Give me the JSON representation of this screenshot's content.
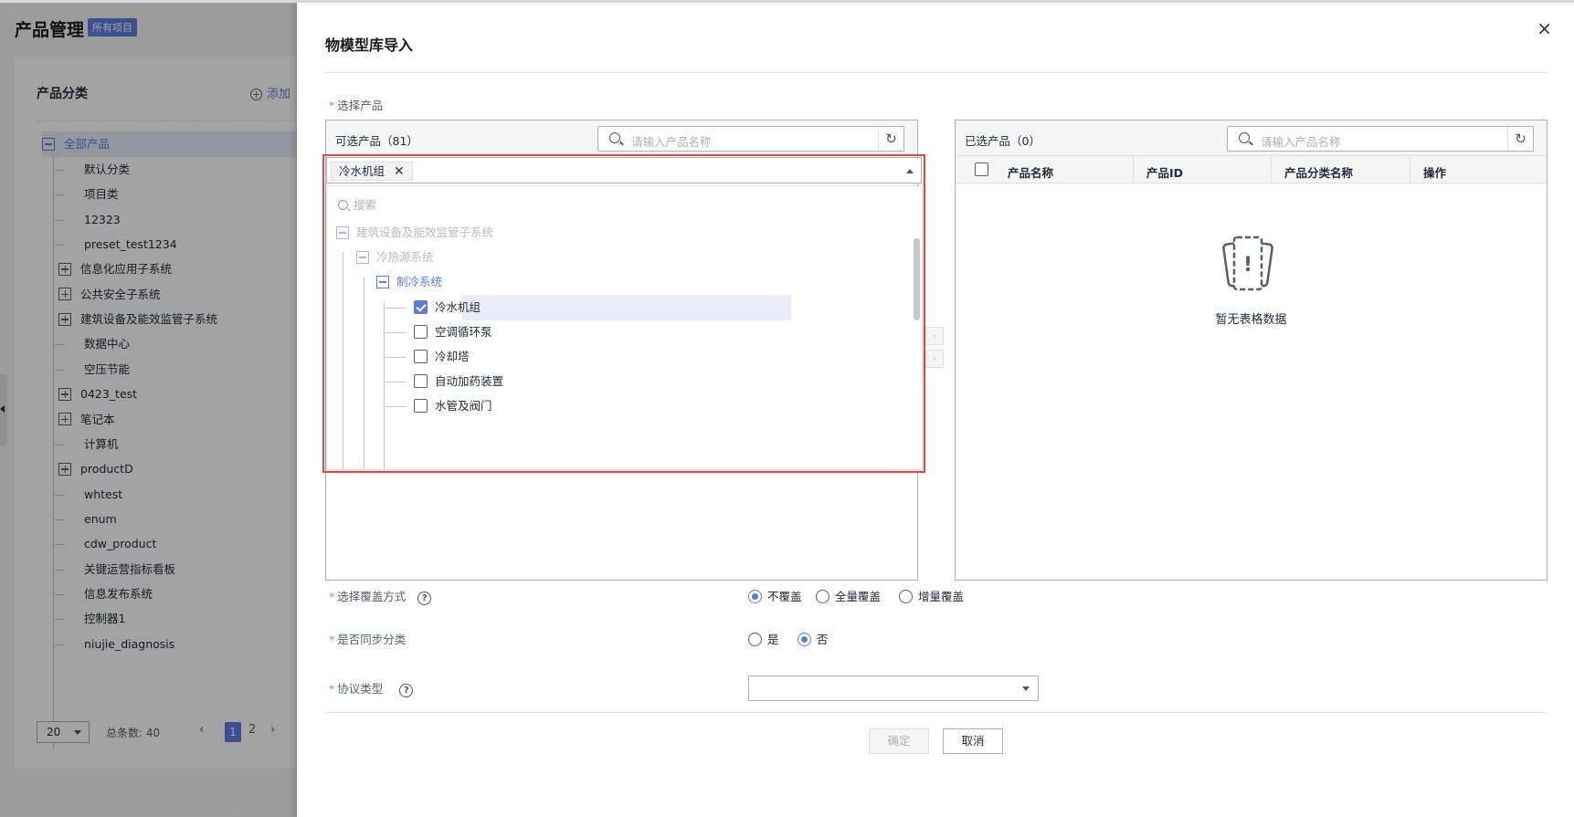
{
  "background": {
    "title": "产品管理",
    "badge": "所有项目",
    "category_title": "产品分类",
    "add_label": "添加",
    "root": "全部产品",
    "items": [
      {
        "label": "默认分类",
        "expandable": false
      },
      {
        "label": "项目类",
        "expandable": false
      },
      {
        "label": "12323",
        "expandable": false
      },
      {
        "label": "preset_test1234",
        "expandable": false
      },
      {
        "label": "信息化应用子系统",
        "expandable": true
      },
      {
        "label": "公共安全子系统",
        "expandable": true
      },
      {
        "label": "建筑设备及能效监管子系统",
        "expandable": true
      },
      {
        "label": "数据中心",
        "expandable": false
      },
      {
        "label": "空压节能",
        "expandable": false
      },
      {
        "label": "0423_test",
        "expandable": true
      },
      {
        "label": "笔记本",
        "expandable": true
      },
      {
        "label": "计算机",
        "expandable": false
      },
      {
        "label": "productD",
        "expandable": true
      },
      {
        "label": "whtest",
        "expandable": false
      },
      {
        "label": "enum",
        "expandable": false
      },
      {
        "label": "cdw_product",
        "expandable": false
      },
      {
        "label": "关键运营指标看板",
        "expandable": false
      },
      {
        "label": "信息发布系统",
        "expandable": false
      },
      {
        "label": "控制器1",
        "expandable": false
      },
      {
        "label": "niujie_diagnosis",
        "expandable": false
      }
    ],
    "pager": {
      "page_size": "20",
      "total": "总条数: 40",
      "current": "1",
      "next_page": "2",
      "prev": "‹",
      "next": "›"
    }
  },
  "drawer": {
    "title": "物模型库导入",
    "close": "×",
    "select_product_label": "选择产品",
    "left_panel": {
      "title": "可选产品（81）",
      "search_placeholder": "请输入产品名称",
      "refresh": "↻"
    },
    "selected_tag": "冷水机组",
    "tag_close": "✕",
    "dropdown": {
      "search_placeholder": "搜索",
      "nodes": [
        {
          "label": "建筑设备及能效监管子系统",
          "level": 0,
          "state": "group-faded"
        },
        {
          "label": "冷热源系统",
          "level": 1,
          "state": "group-faded"
        },
        {
          "label": "制冷系统",
          "level": 2,
          "state": "group-active"
        },
        {
          "label": "冷水机组",
          "level": 3,
          "checked": true
        },
        {
          "label": "空调循环泵",
          "level": 3,
          "checked": false
        },
        {
          "label": "冷却塔",
          "level": 3,
          "checked": false
        },
        {
          "label": "自动加药装置",
          "level": 3,
          "checked": false
        },
        {
          "label": "水管及阀门",
          "level": 3,
          "checked": false
        }
      ]
    },
    "transfer_right": "›",
    "transfer_left": "‹",
    "right_panel": {
      "title": "已选产品（0）",
      "search_placeholder": "请输入产品名称",
      "refresh": "↻",
      "columns": [
        "产品名称",
        "产品ID",
        "产品分类名称",
        "操作"
      ],
      "empty_text": "暂无表格数据",
      "empty_icon": "!"
    },
    "overwrite": {
      "label": "选择覆盖方式",
      "help": "?",
      "options": [
        {
          "label": "不覆盖",
          "selected": true
        },
        {
          "label": "全量覆盖",
          "selected": false
        },
        {
          "label": "增量覆盖",
          "selected": false
        }
      ]
    },
    "sync": {
      "label": "是否同步分类",
      "options": [
        {
          "label": "是",
          "selected": false
        },
        {
          "label": "否",
          "selected": true
        }
      ]
    },
    "protocol": {
      "label": "协议类型",
      "help": "?",
      "value": ""
    },
    "confirm": "确定",
    "cancel": "取消",
    "required_mark": "*"
  },
  "colors": {
    "accent": "#5e7ce0",
    "required": "#f66f6a",
    "highlight_border": "#e54545"
  }
}
